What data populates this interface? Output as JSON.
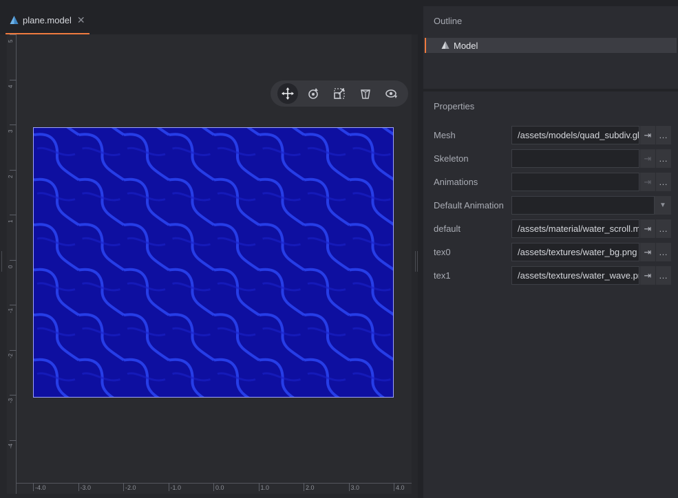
{
  "tab": {
    "title": "plane.model",
    "close_glyph": "✕",
    "icon": "model-icon"
  },
  "toolbar": {
    "tools": [
      {
        "name": "move-tool",
        "icon": "move-icon",
        "active": true
      },
      {
        "name": "rotate-tool",
        "icon": "rotate-icon",
        "active": false
      },
      {
        "name": "scale-tool",
        "icon": "scale-icon",
        "active": false
      },
      {
        "name": "perspective-tool",
        "icon": "perspective-icon",
        "active": false
      },
      {
        "name": "camera-tool",
        "icon": "camera-icon",
        "active": false
      }
    ]
  },
  "rulers": {
    "vertical_labels": [
      "5",
      "4",
      "3",
      "2",
      "1",
      "0",
      "-1",
      "-2",
      "-3",
      "-4"
    ],
    "horizontal_labels": [
      "-4.0",
      "-3.0",
      "-2.0",
      "-1.0",
      "0.0",
      "1.0",
      "2.0",
      "3.0",
      "4.0"
    ]
  },
  "colors": {
    "accent": "#f07b3f",
    "plane_fill": "#0e0fa0",
    "plane_wave": "#2f4dff"
  },
  "outline": {
    "title": "Outline",
    "item": {
      "label": "Model",
      "icon": "model-icon"
    }
  },
  "properties": {
    "title": "Properties",
    "rows": [
      {
        "label": "Mesh",
        "value": "/assets/models/quad_subdiv.glb",
        "kind": "resource",
        "goto_enabled": true
      },
      {
        "label": "Skeleton",
        "value": "",
        "kind": "resource",
        "goto_enabled": false
      },
      {
        "label": "Animations",
        "value": "",
        "kind": "resource",
        "goto_enabled": false
      },
      {
        "label": "Default Animation",
        "value": "",
        "kind": "select"
      },
      {
        "label": "default",
        "value": "/assets/material/water_scroll.material",
        "kind": "resource",
        "goto_enabled": true
      },
      {
        "label": "tex0",
        "value": "/assets/textures/water_bg.png",
        "kind": "resource",
        "goto_enabled": true
      },
      {
        "label": "tex1",
        "value": "/assets/textures/water_wave.png",
        "kind": "resource",
        "goto_enabled": true
      }
    ],
    "goto_glyph": "⇥",
    "more_glyph": "…",
    "select_glyph": "▼"
  }
}
